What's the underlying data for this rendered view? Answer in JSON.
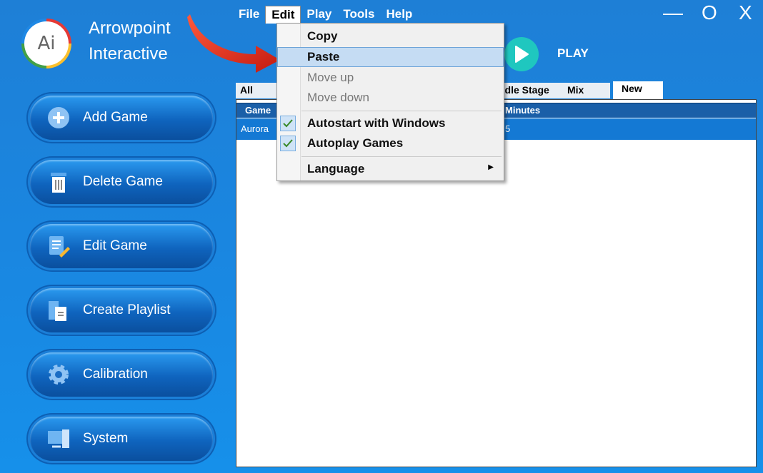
{
  "app": {
    "logo_text": "Ai",
    "brand_line1": "Arrowpoint",
    "brand_line2": "Interactive"
  },
  "menubar": [
    "File",
    "Edit",
    "Play",
    "Tools",
    "Help"
  ],
  "window_controls": {
    "minimize": "—",
    "maximize": "O",
    "close": "X"
  },
  "play": {
    "label": "PLAY"
  },
  "tabs": {
    "all": "All",
    "middle_stage": "ddle Stage",
    "mix": "Mix",
    "new": "New"
  },
  "list": {
    "col_game": "Game",
    "col_minutes": "Minutes",
    "row1_name": "Aurora",
    "row1_minutes": "5"
  },
  "sidebar": {
    "add": "Add Game",
    "delete": "Delete Game",
    "edit": "Edit Game",
    "playlist": "Create Playlist",
    "calibration": "Calibration",
    "system": "System"
  },
  "edit_menu": {
    "copy": "Copy",
    "paste": "Paste",
    "move_up": "Move up",
    "move_down": "Move down",
    "autostart": "Autostart with Windows",
    "autoplay": "Autoplay Games",
    "language": "Language",
    "autostart_checked": true,
    "autoplay_checked": true
  },
  "colors": {
    "accent": "#1a86e0",
    "play": "#1fc7bf",
    "highlight": "#c5dcf3",
    "selected_row": "#1479d4"
  }
}
